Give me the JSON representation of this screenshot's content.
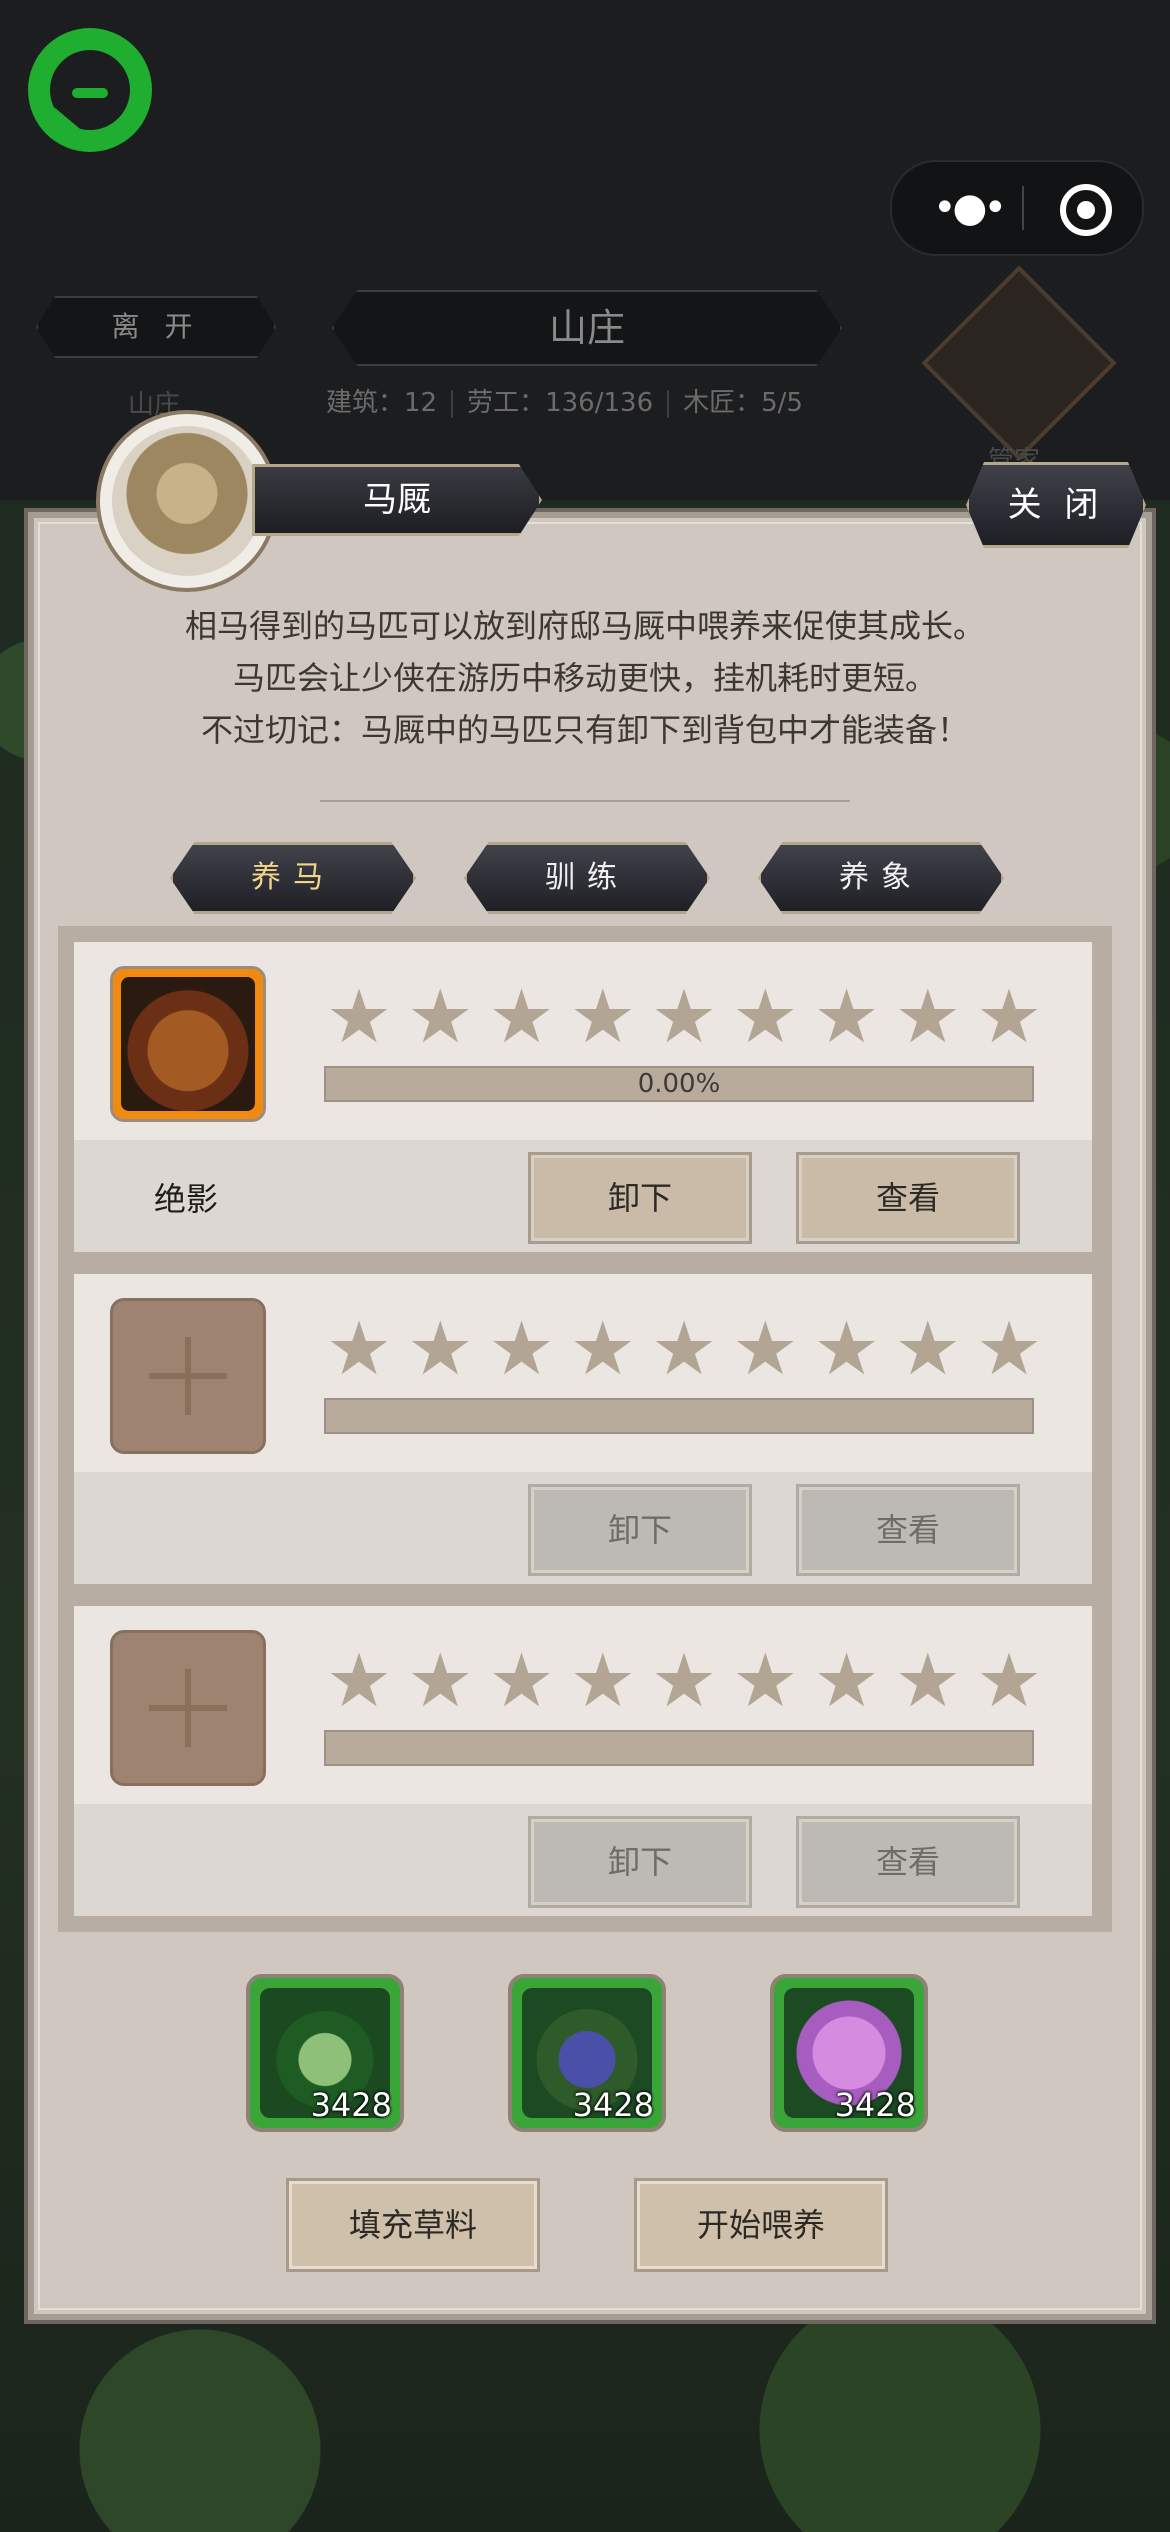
{
  "header": {
    "leave_label": "离 开",
    "title": "山庄",
    "stats": {
      "buildings": "建筑：12",
      "labor": "劳工：136/136",
      "carpenter": "木匠：5/5"
    },
    "ghost_left": "山庄",
    "ghost_right": "管家"
  },
  "panel": {
    "name": "马厩",
    "close_label": "关 闭",
    "description": [
      "相马得到的马匹可以放到府邸马厩中喂养来促使其成长。",
      "马匹会让少侠在游历中移动更快，挂机耗时更短。",
      "不过切记：马厩中的马匹只有卸下到背包中才能装备！"
    ],
    "tabs": [
      {
        "label": "养马",
        "active": true
      },
      {
        "label": "驯练",
        "active": false
      },
      {
        "label": "养象",
        "active": false
      }
    ],
    "slots": [
      {
        "horse_name": "绝影",
        "progress_text": "0.00%",
        "progress": 0,
        "stars_total": 9,
        "stars_filled": 0,
        "unload_label": "卸下",
        "view_label": "查看",
        "occupied": true
      },
      {
        "horse_name": "",
        "progress_text": "",
        "progress": 0,
        "stars_total": 9,
        "stars_filled": 0,
        "unload_label": "卸下",
        "view_label": "查看",
        "occupied": false
      },
      {
        "horse_name": "",
        "progress_text": "",
        "progress": 0,
        "stars_total": 9,
        "stars_filled": 0,
        "unload_label": "卸下",
        "view_label": "查看",
        "occupied": false
      }
    ],
    "feed_items": [
      {
        "icon": "green-grass-icon",
        "count": "3428"
      },
      {
        "icon": "blue-flower-icon",
        "count": "3428"
      },
      {
        "icon": "purple-flower-icon",
        "count": "3428"
      }
    ],
    "fill_label": "填充草料",
    "start_feed_label": "开始喂养"
  },
  "colors": {
    "panel_bg": "#cfc7c0",
    "item_frame": "#3aa63a",
    "tab_active_text": "#f0d58a"
  }
}
